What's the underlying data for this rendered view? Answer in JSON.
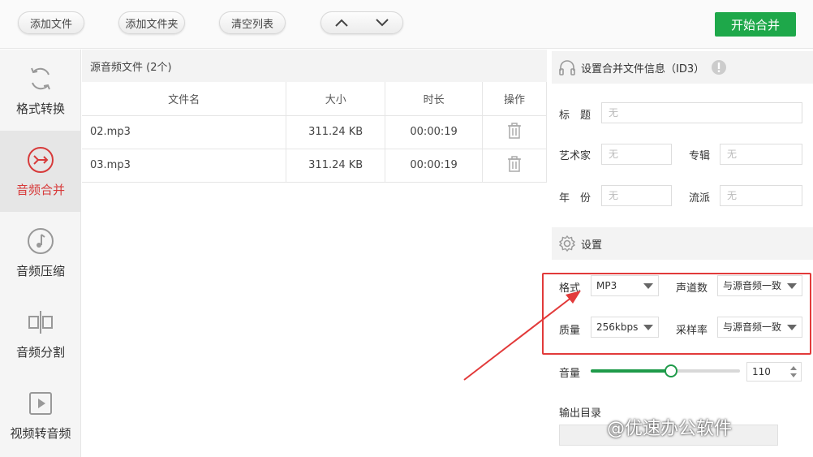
{
  "toolbar": {
    "add_file": "添加文件",
    "add_folder": "添加文件夹",
    "clear_list": "清空列表",
    "start_merge": "开始合并"
  },
  "sidebar": {
    "items": [
      {
        "label": "格式转换",
        "icon": "refresh-icon"
      },
      {
        "label": "音频合并",
        "icon": "merge-icon"
      },
      {
        "label": "音频压缩",
        "icon": "music-note-icon"
      },
      {
        "label": "音频分割",
        "icon": "split-icon"
      },
      {
        "label": "视频转音频",
        "icon": "video-play-icon"
      }
    ],
    "active_index": 1
  },
  "files": {
    "header": "源音频文件 (2个)",
    "columns": [
      "文件名",
      "大小",
      "时长",
      "操作"
    ],
    "rows": [
      {
        "name": "02.mp3",
        "size": "311.24 KB",
        "duration": "00:00:19"
      },
      {
        "name": "03.mp3",
        "size": "311.24 KB",
        "duration": "00:00:19"
      }
    ]
  },
  "id3": {
    "title": "设置合并文件信息（ID3）",
    "fields": {
      "title_label": "标　题",
      "artist_label": "艺术家",
      "album_label": "专辑",
      "year_label": "年　份",
      "genre_label": "流派",
      "placeholder": "无"
    }
  },
  "settings": {
    "title": "设置",
    "format_label": "格式",
    "format_value": "MP3",
    "channels_label": "声道数",
    "channels_value": "与源音频一致",
    "quality_label": "质量",
    "quality_value": "256kbps",
    "samplerate_label": "采样率",
    "samplerate_value": "与源音频一致",
    "volume_label": "音量",
    "volume_value": "110",
    "volume_fraction": 0.54,
    "output_label": "输出目录"
  },
  "watermark": "@优速办公软件",
  "colors": {
    "accent_green": "#1ea84a",
    "active_red": "#d73a3a",
    "highlight_red": "#e23a3a"
  }
}
